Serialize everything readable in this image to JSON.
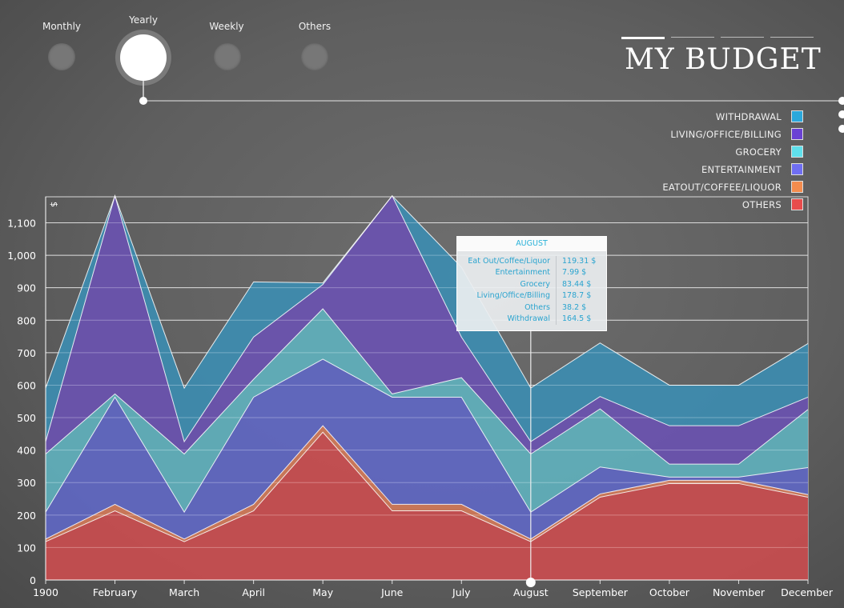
{
  "tabs": [
    {
      "label": "Monthly",
      "active": false
    },
    {
      "label": "Yearly",
      "active": true
    },
    {
      "label": "Weekly",
      "active": false
    },
    {
      "label": "Others",
      "active": false
    }
  ],
  "title": "MY BUDGET",
  "legend": [
    {
      "label": "WITHDRAWAL",
      "color": "#2aa8dc"
    },
    {
      "label": "LIVING/OFFICE/BILLING",
      "color": "#6a42d4"
    },
    {
      "label": "GROCERY",
      "color": "#5fe0ec"
    },
    {
      "label": "ENTERTAINMENT",
      "color": "#6f6ef2"
    },
    {
      "label": "EATOUT/COFFEE/LIQUOR",
      "color": "#f48c4e"
    },
    {
      "label": "OTHERS",
      "color": "#e84c4c"
    }
  ],
  "tooltip": {
    "title": "AUGUST",
    "rows": [
      {
        "label": "Eat Out/Coffee/Liquor",
        "value": "119.31 $"
      },
      {
        "label": "Entertainment",
        "value": "7.99 $"
      },
      {
        "label": "Grocery",
        "value": "83.44 $"
      },
      {
        "label": "Living/Office/Billing",
        "value": "178.7 $"
      },
      {
        "label": "Others",
        "value": "38.2 $"
      },
      {
        "label": "Withdrawal",
        "value": "164.5 $"
      }
    ]
  },
  "chart_data": {
    "type": "area",
    "stacked": true,
    "ylabel": "$",
    "ylim": [
      0,
      1180
    ],
    "yticks": [
      0,
      100,
      200,
      300,
      400,
      500,
      600,
      700,
      800,
      900,
      "1,000",
      "1,100"
    ],
    "ytick_values": [
      0,
      100,
      200,
      300,
      400,
      500,
      600,
      700,
      800,
      900,
      1000,
      1100
    ],
    "categories": [
      "1900",
      "February",
      "March",
      "April",
      "May",
      "June",
      "July",
      "August",
      "September",
      "October",
      "November",
      "December"
    ],
    "grid": true,
    "highlight_category": "August",
    "series": [
      {
        "name": "OTHERS",
        "color": "#c94d4f",
        "values": [
          118,
          213,
          118,
          213,
          455,
          213,
          213,
          118,
          255,
          297,
          297,
          255
        ]
      },
      {
        "name": "EATOUT/COFFEE/LIQUOR",
        "color": "#d07858",
        "values": [
          8,
          20,
          8,
          20,
          20,
          20,
          20,
          8,
          10,
          10,
          10,
          8
        ]
      },
      {
        "name": "ENTERTAINMENT",
        "color": "#5f67c2",
        "values": [
          83,
          330,
          83,
          330,
          205,
          330,
          330,
          83,
          83,
          10,
          10,
          83
        ]
      },
      {
        "name": "GROCERY",
        "color": "#5fb0bc",
        "values": [
          179,
          10,
          179,
          55,
          155,
          10,
          60,
          179,
          179,
          40,
          40,
          179
        ]
      },
      {
        "name": "LIVING/OFFICE/BILLING",
        "color": "#6a52b0",
        "values": [
          38,
          610,
          38,
          130,
          75,
          610,
          125,
          38,
          38,
          118,
          118,
          38
        ]
      },
      {
        "name": "WITHDRAWAL",
        "color": "#3d8cb0",
        "values": [
          165,
          0,
          165,
          170,
          5,
          0,
          215,
          165,
          165,
          125,
          125,
          165
        ]
      }
    ]
  }
}
